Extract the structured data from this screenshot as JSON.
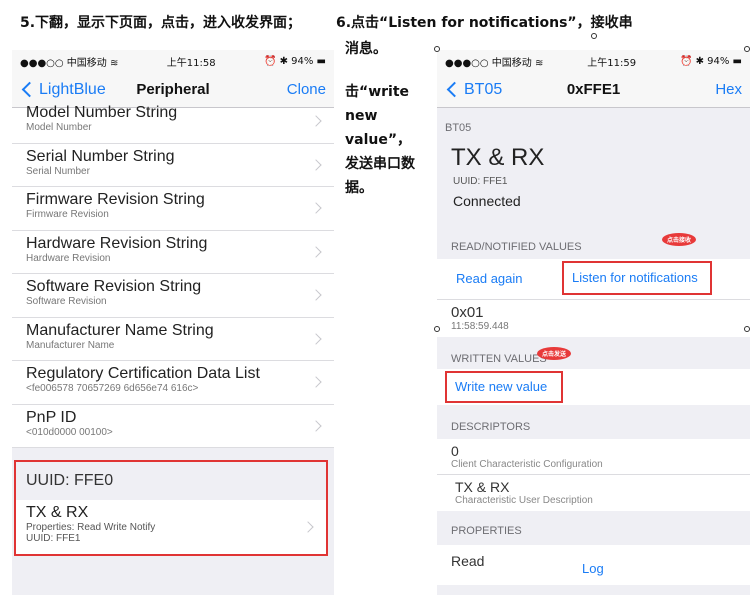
{
  "captions": {
    "step5": "5.下翻，显示下页面，点击，进入收发界面；",
    "step6_line1": "6.点击“Listen for notifications”，接收串",
    "step6_line2": "消息。",
    "step6_line3": "击“write new value”，发送串口数据。"
  },
  "phone1": {
    "status": {
      "carrier": "●●●○○ 中国移动 ≋",
      "time": "上午11:58",
      "battery": "⏰ ✱ 94% ▬"
    },
    "nav": {
      "back": "LightBlue",
      "title": "Peripheral",
      "right": "Clone"
    },
    "rows": [
      {
        "title": "Model Number String",
        "sub": "Model Number"
      },
      {
        "title": "Serial Number String",
        "sub": "Serial Number"
      },
      {
        "title": "Firmware Revision String",
        "sub": "Firmware Revision"
      },
      {
        "title": "Hardware Revision String",
        "sub": "Hardware Revision"
      },
      {
        "title": "Software Revision String",
        "sub": "Software Revision"
      },
      {
        "title": "Manufacturer Name String",
        "sub": "Manufacturer Name"
      },
      {
        "title": "Regulatory Certification Data List",
        "sub": "<fe006578 70657269 6d656e74 616c>"
      },
      {
        "title": "PnP ID",
        "sub": "<010d0000 00100>"
      }
    ],
    "uuid": {
      "header": "UUID: FFE0",
      "char_title": "TX & RX",
      "char_props": "Properties: Read Write Notify",
      "char_uuid": "UUID: FFE1"
    }
  },
  "phone2": {
    "status": {
      "carrier": "●●●○○ 中国移动 ≋",
      "time": "上午11:59",
      "battery": "⏰ ✱ 94% ▬"
    },
    "nav": {
      "back": "BT05",
      "title": "0xFFE1",
      "right": "Hex"
    },
    "device": "BT05",
    "char_name": "TX & RX",
    "uuid": "UUID: FFE1",
    "state": "Connected",
    "read_section": "READ/NOTIFIED VALUES",
    "read_again": "Read again",
    "listen": "Listen for notifications",
    "stamp1": "点击接收",
    "value": "0x01",
    "value_time": "11:58:59.448",
    "written_section": "WRITTEN VALUES",
    "stamp2": "点击发送",
    "write_new": "Write new value",
    "descriptors_section": "DESCRIPTORS",
    "desc1_value": "0",
    "desc1_name": "Client Characteristic Configuration",
    "desc2_value": "TX & RX",
    "desc2_name": "Characteristic User Description",
    "properties_section": "PROPERTIES",
    "prop_first": "Read",
    "log": "Log"
  }
}
